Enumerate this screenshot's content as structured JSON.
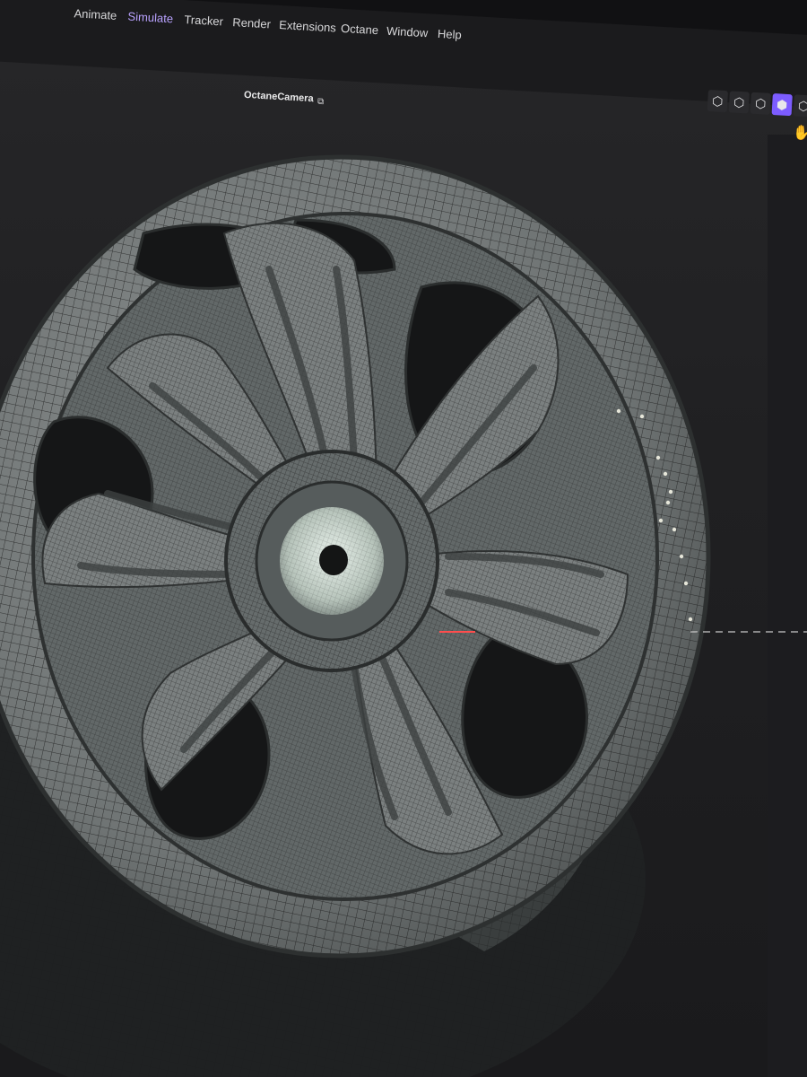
{
  "menubar": {
    "items": [
      {
        "label": "Animate",
        "active": false
      },
      {
        "label": "Simulate",
        "active": true
      },
      {
        "label": "Tracker",
        "active": false
      },
      {
        "label": "Render",
        "active": false
      },
      {
        "label": "Extensions",
        "active": false
      },
      {
        "label": "Octane",
        "active": false
      },
      {
        "label": "Window",
        "active": false
      },
      {
        "label": "Help",
        "active": false
      }
    ]
  },
  "viewport": {
    "camera_name": "OctaneCamera",
    "camera_lock_icon": "camera-lock-icon",
    "toolbar_icons": [
      "cube-front-icon",
      "cube-side-icon",
      "cube-top-icon",
      "cube-perspective-icon",
      "cube-extra-icon"
    ],
    "active_toolbar_icon": "cube-perspective-icon"
  },
  "colors": {
    "accent": "#7c5cff",
    "active_menu_text": "#b9a2ff",
    "menubar_bg": "#1b1b1d",
    "viewport_bg": "#242426",
    "wireframe_surface": "#7d8282",
    "wire_lines": "#1c1c1c"
  },
  "scene": {
    "object": "wheel-rim",
    "display_mode": "wireframe-shaded"
  }
}
